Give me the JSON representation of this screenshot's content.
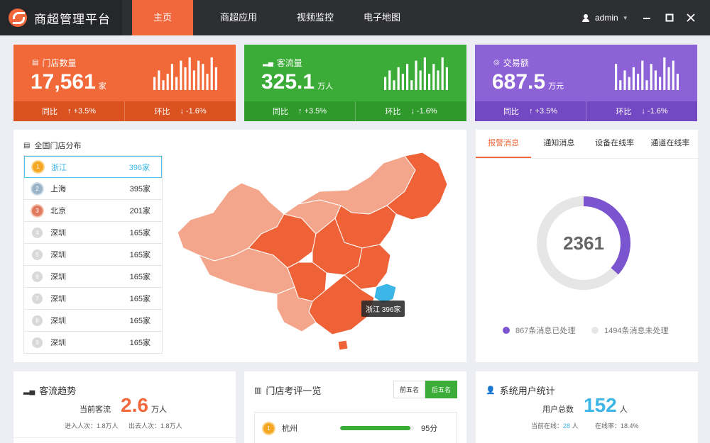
{
  "app": {
    "title": "商超管理平台"
  },
  "nav": {
    "items": [
      "主页",
      "商超应用",
      "视频监控",
      "电子地图"
    ],
    "active_index": 0
  },
  "user": {
    "name": "admin"
  },
  "stats": [
    {
      "title": "门店数量",
      "value": "17,561",
      "unit": "家",
      "yoy_label": "同比",
      "yoy_value": "+3.5%",
      "mom_label": "环比",
      "mom_value": "-1.6%",
      "color": "#f26939",
      "bars": [
        4,
        6,
        3,
        5,
        8,
        4,
        9,
        7,
        10,
        6,
        9,
        8,
        5,
        10,
        7
      ]
    },
    {
      "title": "客流量",
      "value": "325.1",
      "unit": "万人",
      "yoy_label": "同比",
      "yoy_value": "+3.5%",
      "mom_label": "环比",
      "mom_value": "-1.6%",
      "color": "#3cac38",
      "bars": [
        4,
        6,
        3,
        7,
        5,
        8,
        3,
        9,
        6,
        10,
        5,
        8,
        6,
        10,
        7
      ]
    },
    {
      "title": "交易额",
      "value": "687.5",
      "unit": "万元",
      "yoy_label": "同比",
      "yoy_value": "+3.5%",
      "mom_label": "环比",
      "mom_value": "-1.6%",
      "color": "#8d62d6",
      "bars": [
        8,
        3,
        6,
        4,
        7,
        5,
        9,
        3,
        8,
        6,
        4,
        10,
        7,
        9,
        5
      ]
    }
  ],
  "store_distribution": {
    "title": "全国门店分布",
    "ranking": [
      {
        "rank": "1",
        "city": "浙江",
        "count": "396家"
      },
      {
        "rank": "2",
        "city": "上海",
        "count": "395家"
      },
      {
        "rank": "3",
        "city": "北京",
        "count": "201家"
      },
      {
        "rank": "4",
        "city": "深圳",
        "count": "165家"
      },
      {
        "rank": "5",
        "city": "深圳",
        "count": "165家"
      },
      {
        "rank": "6",
        "city": "深圳",
        "count": "165家"
      },
      {
        "rank": "7",
        "city": "深圳",
        "count": "165家"
      },
      {
        "rank": "8",
        "city": "深圳",
        "count": "165家"
      },
      {
        "rank": "9",
        "city": "深圳",
        "count": "165家"
      }
    ],
    "tooltip": "浙江  396家",
    "map_colors": {
      "light": "#f4a68c",
      "dark": "#ef6238",
      "highlight": "#3cb6e6"
    }
  },
  "alerts": {
    "tabs": [
      "报警消息",
      "通知消息",
      "设备在线率",
      "通道在线率"
    ],
    "active_tab": 0,
    "total": "2361",
    "processed_ratio": 0.367,
    "processed_label": "867条消息已处理",
    "unprocessed_label": "1494条消息未处理",
    "processed_color": "#7b55cf",
    "unprocessed_color": "#e6e6e6"
  },
  "traffic_trend": {
    "title": "客流趋势",
    "current_label": "当前客流",
    "current_value": "2.6",
    "current_unit": "万人",
    "in_text": "进入人次：1.8万人",
    "out_text": "出去人次：1.8万人"
  },
  "store_review": {
    "title": "门店考评一览",
    "btn_top": "前五名",
    "btn_bottom": "后五名",
    "first_item": {
      "rank": "1",
      "name": "杭州",
      "score": "95分",
      "progress": 0.95
    }
  },
  "user_stats": {
    "title": "系统用户统计",
    "total_label": "用户总数",
    "total_value": "152",
    "total_unit": "人",
    "online_prefix": "当前在线：",
    "online_value": "28",
    "online_unit": "人",
    "online_rate": "在线率：18.4%"
  }
}
